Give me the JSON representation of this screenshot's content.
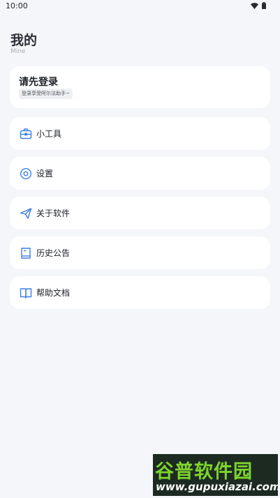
{
  "status_bar": {
    "time": "10:00",
    "icons": [
      "wifi-icon",
      "battery-icon"
    ]
  },
  "header": {
    "title": "我的",
    "subtitle": "Mine"
  },
  "login_card": {
    "title": "请先登录",
    "hint": "登录享受阿尔法助手~"
  },
  "menu": [
    {
      "label": "小工具",
      "icon": "toolbox-icon"
    },
    {
      "label": "设置",
      "icon": "settings-icon"
    },
    {
      "label": "关于软件",
      "icon": "send-icon"
    },
    {
      "label": "历史公告",
      "icon": "notice-icon"
    },
    {
      "label": "帮助文档",
      "icon": "book-icon"
    }
  ],
  "watermark": {
    "brand": "谷普软件园",
    "url": "www.gupuxiazai.com"
  },
  "colors": {
    "background": "#f5f6f9",
    "card": "#ffffff",
    "icon_accent": "#3d7fe0",
    "watermark_green": "#7fd42c"
  }
}
